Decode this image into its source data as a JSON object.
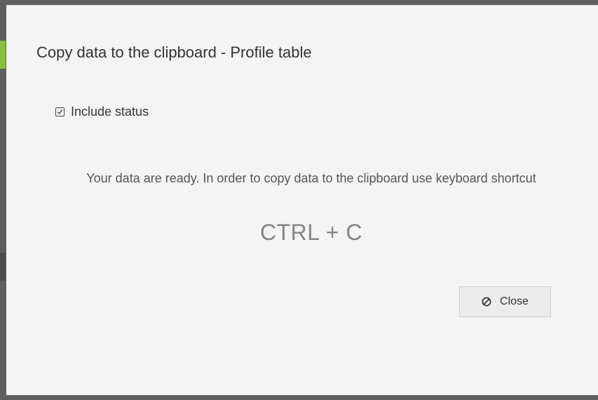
{
  "dialog": {
    "title": "Copy data to the clipboard - Profile table",
    "option": {
      "label": "Include status",
      "checked": true,
      "icon": "checkbox-checked-icon"
    },
    "message": "Your data are ready. In order to copy data to the clipboard use keyboard shortcut",
    "shortcut": "CTRL + C",
    "close_button": {
      "label": "Close",
      "icon": "ban-icon"
    }
  }
}
